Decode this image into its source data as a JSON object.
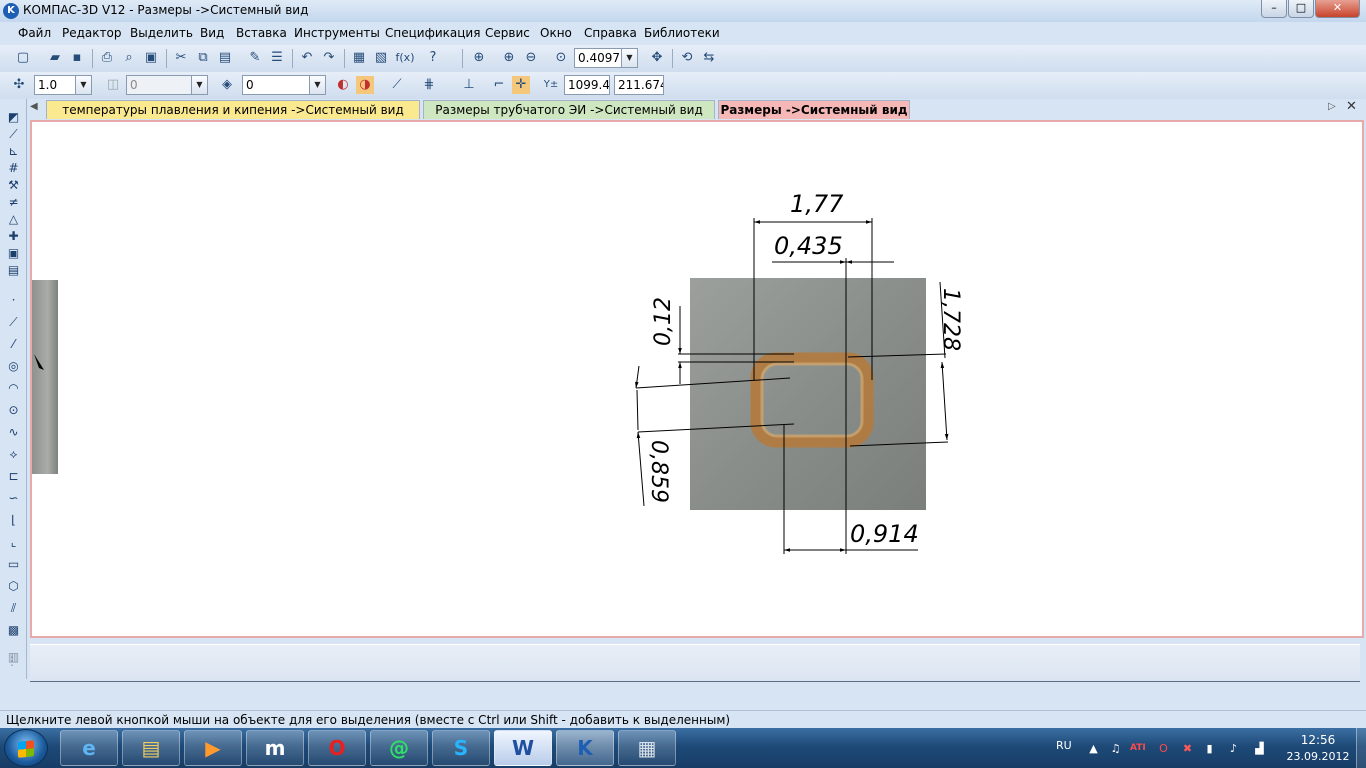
{
  "window": {
    "title": "КОМПАС-3D V12 - Размеры ->Системный вид",
    "controls": {
      "minimize": "–",
      "maximize": "□",
      "close": "✕"
    }
  },
  "menu": [
    "Файл",
    "Редактор",
    "Выделить",
    "Вид",
    "Вставка",
    "Инструменты",
    "Спецификация",
    "Сервис",
    "Окно",
    "Справка",
    "Библиотеки"
  ],
  "toolbar1": {
    "zoom_value": "0.4097"
  },
  "toolbar2": {
    "step_value": "1.0",
    "angle_value": "0",
    "layer_value": "0",
    "coord_x": "1099.4",
    "coord_y": "211.674"
  },
  "tabs": [
    {
      "label": "температуры плавления и кипения ->Системный вид",
      "color": "#fbe98f"
    },
    {
      "label": "Размеры трубчатого ЭИ ->Системный вид",
      "color": "#cfe7c0"
    },
    {
      "label": "Размеры ->Системный вид",
      "color": "#f6b7b7",
      "active": true
    }
  ],
  "drawing": {
    "dimensions": {
      "d1": "1,77",
      "d2": "0,435",
      "d3": "0,12",
      "d4": "1,728",
      "d5": "0,859",
      "d6": "0,914"
    }
  },
  "status": {
    "text": "Щелкните левой кнопкой мыши на объекте для его выделения (вместе с Ctrl или Shift - добавить к выделенным)"
  },
  "taskbar": {
    "tray_lang": "RU",
    "time": "12:56",
    "date": "23.09.2012",
    "apps": [
      {
        "name": "ie",
        "glyph": "e"
      },
      {
        "name": "explorer",
        "glyph": "▤"
      },
      {
        "name": "media-player",
        "glyph": "▶"
      },
      {
        "name": "app-m",
        "glyph": "m"
      },
      {
        "name": "opera",
        "glyph": "O"
      },
      {
        "name": "mail-agent",
        "glyph": "@"
      },
      {
        "name": "skype",
        "glyph": "S"
      },
      {
        "name": "word",
        "glyph": "W"
      },
      {
        "name": "kompas",
        "glyph": "K"
      },
      {
        "name": "calculator",
        "glyph": "▦"
      }
    ]
  }
}
